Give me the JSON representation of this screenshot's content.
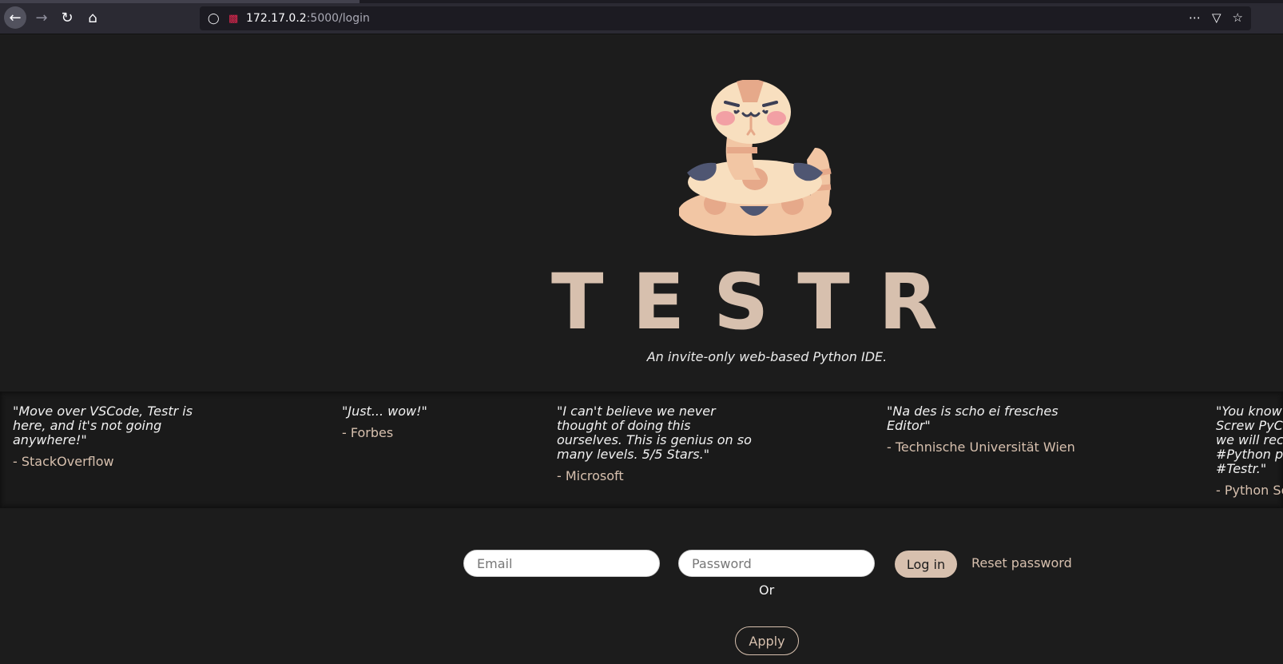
{
  "browser": {
    "url_host": "172.17.0.2",
    "url_path": ":5000/login"
  },
  "hero": {
    "brand": "TESTR",
    "tagline": "An invite-only web-based Python IDE."
  },
  "testimonials": [
    {
      "text": "\"Move over VSCode, Testr is here, and it's not going anywhere!\"",
      "source": "- StackOverflow"
    },
    {
      "text": "\"Just... wow!\"",
      "source": "- Forbes"
    },
    {
      "text": "\"I can't believe we never thought of doing this ourselves. This is genius on so many levels. 5/5 Stars.\"",
      "source": "- Microsoft"
    },
    {
      "text": "\"Na des is scho ei fresches Editor\"",
      "source": "- Technische Universität Wien"
    },
    {
      "text": "\"You know Screw PyC we will rec #Python p #Testr.\"",
      "source": "- Python So"
    }
  ],
  "login": {
    "email_placeholder": "Email",
    "password_placeholder": "Password",
    "login_label": "Log in",
    "reset_label": "Reset password",
    "or_label": "Or",
    "apply_label": "Apply"
  },
  "colors": {
    "background": "#1c1c1c",
    "accent": "#d7c0ae"
  }
}
